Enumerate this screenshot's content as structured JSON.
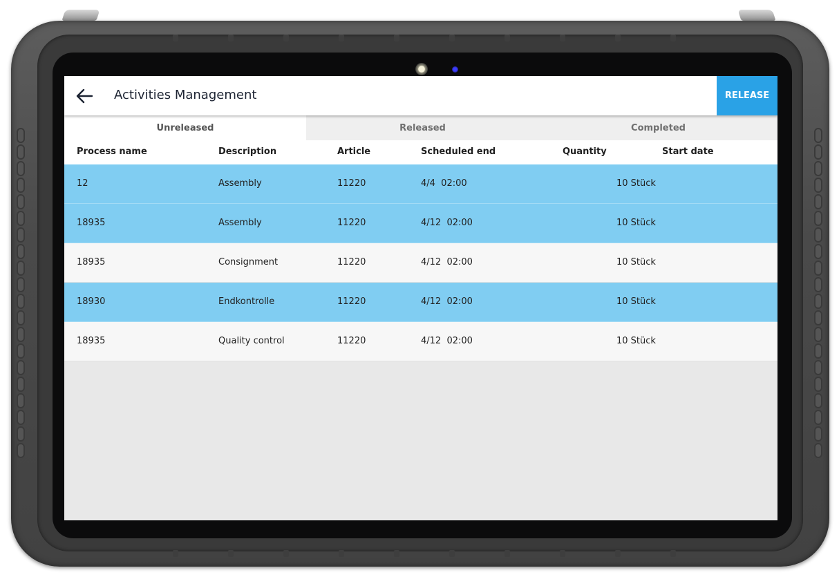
{
  "header": {
    "title": "Activities Management",
    "release_label": "RELEASE"
  },
  "tabs": [
    {
      "label": "Unreleased",
      "active": true
    },
    {
      "label": "Released",
      "active": false
    },
    {
      "label": "Completed",
      "active": false
    }
  ],
  "columns": [
    "Process name",
    "Description",
    "Article",
    "Scheduled end",
    "Quantity",
    "Start date"
  ],
  "rows": [
    {
      "process": "12",
      "description": "Assembly",
      "article": "11220",
      "scheduled_end": "4/4  02:00",
      "quantity": "10 Stück",
      "start_date": "",
      "selected": true
    },
    {
      "process": "18935",
      "description": "Assembly",
      "article": "11220",
      "scheduled_end": "4/12  02:00",
      "quantity": "10 Stück",
      "start_date": "",
      "selected": true
    },
    {
      "process": "18935",
      "description": "Consignment",
      "article": "11220",
      "scheduled_end": "4/12  02:00",
      "quantity": "10 Stück",
      "start_date": "",
      "selected": false
    },
    {
      "process": "18930",
      "description": "Endkontrolle",
      "article": "11220",
      "scheduled_end": "4/12  02:00",
      "quantity": "10 Stück",
      "start_date": "",
      "selected": true
    },
    {
      "process": "18935",
      "description": "Quality control",
      "article": "11220",
      "scheduled_end": "4/12  02:00",
      "quantity": "10 Stück",
      "start_date": "",
      "selected": false
    }
  ],
  "colors": {
    "accent": "#2aa2e6",
    "selected_row": "#80cdf2",
    "device_frame": "#4a4a4a"
  },
  "icons": {
    "back": "arrow-left-icon"
  }
}
